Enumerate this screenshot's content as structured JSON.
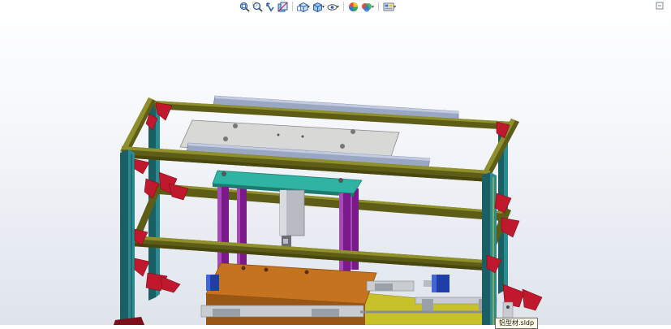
{
  "heads_up_toolbar": {
    "buttons": [
      {
        "name": "zoom-to-fit",
        "icon": "zoom-to-fit-icon"
      },
      {
        "name": "zoom-to-area",
        "icon": "zoom-to-area-icon"
      },
      {
        "name": "previous-view",
        "icon": "previous-view-icon"
      },
      {
        "name": "section-view",
        "icon": "section-view-icon"
      },
      {
        "name": "view-orientation",
        "icon": "view-orientation-icon",
        "dropdown": true
      },
      {
        "name": "display-style",
        "icon": "display-style-icon",
        "dropdown": true
      },
      {
        "name": "hide-show-items",
        "icon": "hide-show-items-icon",
        "dropdown": true
      },
      {
        "name": "edit-appearance",
        "icon": "edit-appearance-icon"
      },
      {
        "name": "apply-scene",
        "icon": "apply-scene-icon",
        "dropdown": true
      },
      {
        "name": "view-settings",
        "icon": "view-settings-icon",
        "dropdown": true
      }
    ],
    "dropdown_glyph": "▾"
  },
  "model": {
    "colors": {
      "frame_upright": "#1f6f73",
      "frame_rail": "#6b6b1e",
      "corner_bracket": "#c0182c",
      "top_plate": "#d6d6d4",
      "top_rails": "#9aa7c2",
      "mounting_plate": "#2fb3a3",
      "guide_posts": "#8b1f9e",
      "base_plate": "#c5731e",
      "cylinder": "#b8bcc2",
      "actuator_blue": "#1f3fa6",
      "yellow_plate": "#c7c12a"
    }
  },
  "tooltip": {
    "text": "铝型材.sldp"
  }
}
